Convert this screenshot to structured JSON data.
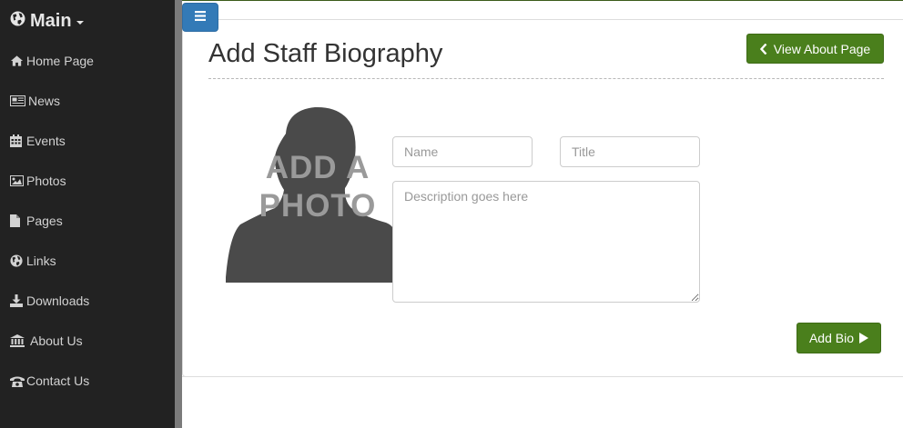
{
  "sidebar": {
    "brand": {
      "label": "Main",
      "icon": "globe-icon"
    },
    "items": [
      {
        "label": "Home Page",
        "icon": "home-icon"
      },
      {
        "label": "News",
        "icon": "newspaper-icon"
      },
      {
        "label": "Events",
        "icon": "calendar-icon"
      },
      {
        "label": "Photos",
        "icon": "picture-icon"
      },
      {
        "label": "Pages",
        "icon": "file-icon"
      },
      {
        "label": "Links",
        "icon": "globe-icon"
      },
      {
        "label": "Downloads",
        "icon": "download-icon"
      },
      {
        "label": "About Us",
        "icon": "bank-icon"
      },
      {
        "label": "Contact Us",
        "icon": "phone-icon"
      }
    ]
  },
  "header": {
    "toggle_icon": "bars-icon",
    "title": "Add Staff Biography",
    "view_about_label": "View About Page",
    "view_about_icon": "chevron-left-icon"
  },
  "form": {
    "photo_text": "ADD A PHOTO",
    "name": {
      "placeholder": "Name",
      "value": ""
    },
    "title": {
      "placeholder": "Title",
      "value": ""
    },
    "description": {
      "placeholder": "Description goes here",
      "value": ""
    },
    "submit_label": "Add Bio",
    "submit_icon": "play-icon"
  },
  "colors": {
    "sidebar_bg": "#222222",
    "accent_green": "#4a7f1c",
    "toggle_blue": "#337ab7"
  }
}
